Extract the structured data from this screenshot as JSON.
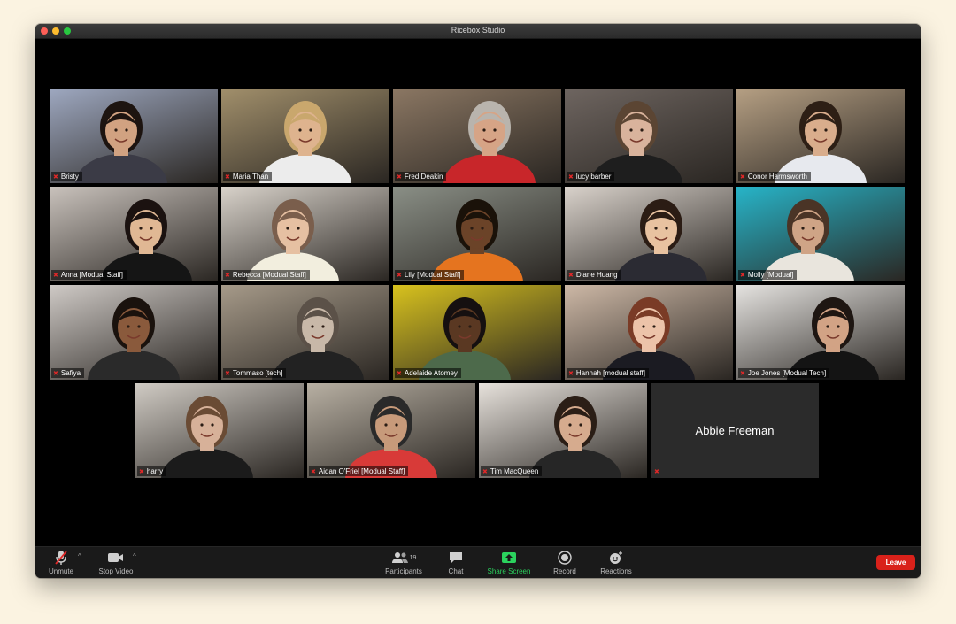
{
  "window": {
    "title": "Ricebox Studio"
  },
  "participants": [
    {
      "name": "Bristy",
      "bg": "#9ea8c0",
      "skin": "#d1a281",
      "hair": "#1d1410",
      "shirt": "#3b3b46"
    },
    {
      "name": "Maria Than",
      "bg": "#a18f6b",
      "skin": "#deb38e",
      "hair": "#c9a76d",
      "shirt": "#ececec"
    },
    {
      "name": "Fred Deakin",
      "bg": "#8b7763",
      "skin": "#d6a486",
      "hair": "#b9b4ad",
      "shirt": "#c8262a"
    },
    {
      "name": "lucy barber",
      "bg": "#6e6560",
      "skin": "#d9b39c",
      "hair": "#5b4533",
      "shirt": "#1e1e1e"
    },
    {
      "name": "Conor Harmsworth",
      "bg": "#b59f83",
      "skin": "#d9ad8c",
      "hair": "#2d1f15",
      "shirt": "#e7e9ee"
    },
    {
      "name": "Anna [Modual Staff]",
      "bg": "#c9c2bc",
      "skin": "#e0b894",
      "hair": "#1b1210",
      "shirt": "#151515"
    },
    {
      "name": "Rebecca [Modual Staff]",
      "bg": "#d8d2ca",
      "skin": "#e6c0a2",
      "hair": "#7a5e4c",
      "shirt": "#f2eede"
    },
    {
      "name": "Lily [Modual Staff]",
      "bg": "#8a8f86",
      "skin": "#6b4328",
      "hair": "#1a1209",
      "shirt": "#e5741f"
    },
    {
      "name": "Diane Huang",
      "bg": "#d9d2cb",
      "skin": "#e8c2a0",
      "hair": "#2b1c14",
      "shirt": "#2b2b33"
    },
    {
      "name": "Molly [Modual]",
      "bg": "#27b4c8",
      "skin": "#cfa486",
      "hair": "#4a3426",
      "shirt": "#e9e5dd"
    },
    {
      "name": "Safiya",
      "bg": "#cfcac6",
      "skin": "#8a5a3c",
      "hair": "#1a120d",
      "shirt": "#2a2a2a"
    },
    {
      "name": "Tommaso [tech]",
      "bg": "#a69a89",
      "skin": "#c8b8a8",
      "hair": "#5b5148",
      "shirt": "#222222"
    },
    {
      "name": "Adelaide Atomey",
      "bg": "#d8c21e",
      "skin": "#5a3822",
      "hair": "#151010",
      "shirt": "#4d6a4b"
    },
    {
      "name": "Hannah [modual staff]",
      "bg": "#cdb8a6",
      "skin": "#ecc3a9",
      "hair": "#7a3b26",
      "shirt": "#1b1b22"
    },
    {
      "name": "Joe Jones [Modual Tech]",
      "bg": "#e5e3e0",
      "skin": "#d2a385",
      "hair": "#1e1612",
      "shirt": "#141414"
    },
    {
      "name": "harry",
      "bg": "#d0cbc4",
      "skin": "#d7b199",
      "hair": "#6a4b34",
      "shirt": "#1b1b1b"
    },
    {
      "name": "Aidan O'Friel [Modual Staff]",
      "bg": "#b8b0a3",
      "skin": "#c79a7a",
      "hair": "#2a2a2a",
      "shirt": "#d83a38"
    },
    {
      "name": "Tim MacQueen",
      "bg": "#e7e2dc",
      "skin": "#d6ab8e",
      "hair": "#2b1e16",
      "shirt": "#262626"
    },
    {
      "name": "Abbie Freeman",
      "video_off": true
    }
  ],
  "toolbar": {
    "unmute_label": "Unmute",
    "stop_video_label": "Stop Video",
    "participants_label": "Participants",
    "participants_count": "19",
    "chat_label": "Chat",
    "share_label": "Share Screen",
    "record_label": "Record",
    "reactions_label": "Reactions",
    "leave_label": "Leave"
  },
  "colors": {
    "leave": "#d9211a",
    "share": "#2bd35e",
    "muted_mic": "#e02828"
  }
}
